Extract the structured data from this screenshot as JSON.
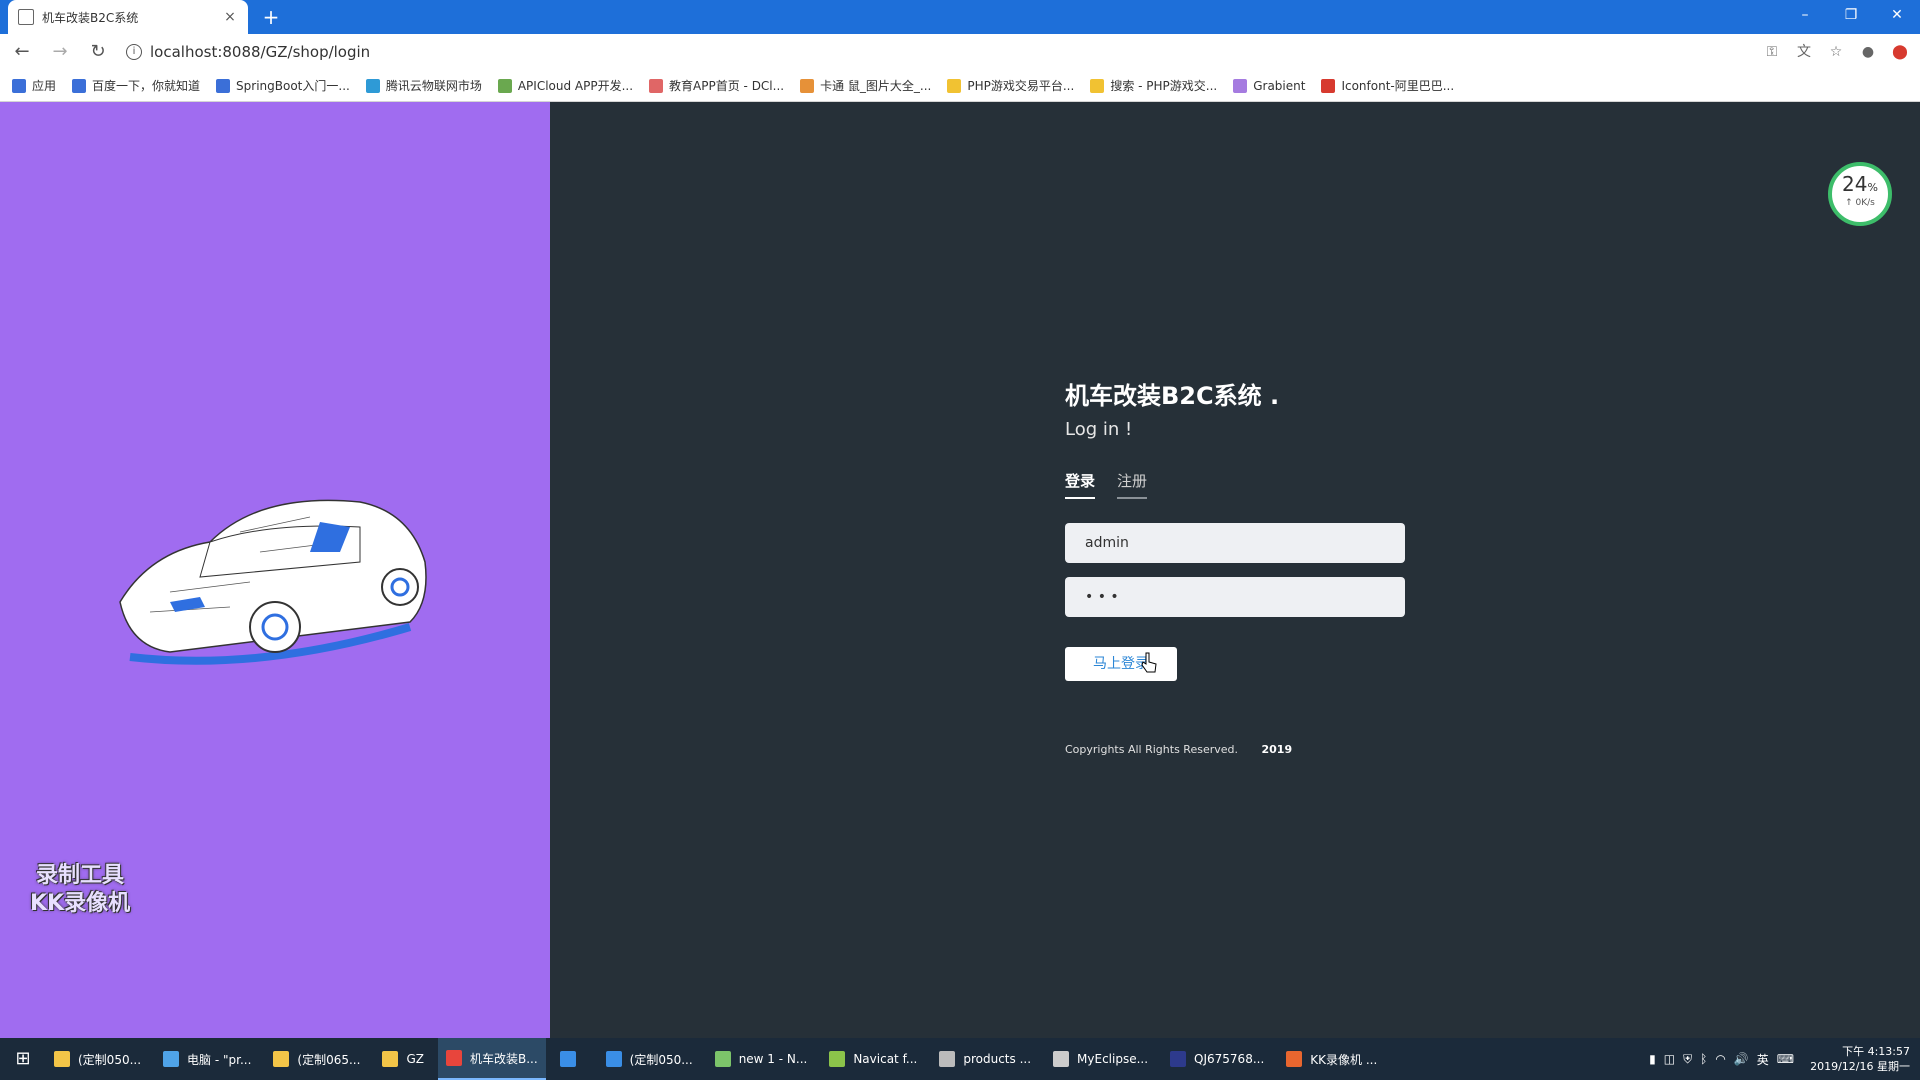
{
  "browser": {
    "tab_title": "机车改装B2C系统",
    "tab_close": "×",
    "new_tab": "+",
    "url": "localhost:8088/GZ/shop/login",
    "window_controls": [
      "–",
      "❐",
      "✕"
    ]
  },
  "bookmarks": [
    {
      "label": "应用",
      "color": "#3b6fd8"
    },
    {
      "label": "百度一下，你就知道",
      "color": "#3b6fd8"
    },
    {
      "label": "SpringBoot入门一...",
      "color": "#3b6fd8"
    },
    {
      "label": "腾讯云物联网市场",
      "color": "#2e9ad6"
    },
    {
      "label": "APICloud APP开发...",
      "color": "#6aa84f"
    },
    {
      "label": "教育APP首页 - DCl...",
      "color": "#e06666"
    },
    {
      "label": "卡通 鼠_图片大全_...",
      "color": "#e69138"
    },
    {
      "label": "PHP游戏交易平台...",
      "color": "#f1c232"
    },
    {
      "label": "搜索 - PHP游戏交...",
      "color": "#f1c232"
    },
    {
      "label": "Grabient",
      "color": "#a57be0"
    },
    {
      "label": "Iconfont-阿里巴巴...",
      "color": "#d73a2f"
    }
  ],
  "speed_widget": {
    "percent": "24",
    "unit": "%",
    "rate": "↑ 0K/s"
  },
  "login": {
    "title": "机车改装B2C系统 .",
    "subtitle": "Log in !",
    "tab_login": "登录",
    "tab_register": "注册",
    "username_value": "admin",
    "password_mask": "• • •",
    "submit_label": "马上登录",
    "copyright": "Copyrights All Rights Reserved.",
    "year": "2019"
  },
  "watermark": {
    "line1": "录制工具",
    "line2": "KK录像机"
  },
  "taskbar": {
    "items": [
      {
        "label": "(定制050...",
        "color": "#f3c548"
      },
      {
        "label": "电脑 - \"pr...",
        "color": "#4fa3e8"
      },
      {
        "label": "(定制065...",
        "color": "#f3c548"
      },
      {
        "label": "GZ",
        "color": "#f3c548"
      },
      {
        "label": "机车改装B...",
        "color": "#e8453c",
        "active": true
      },
      {
        "label": "",
        "color": "#3a8ee6"
      },
      {
        "label": "(定制050...",
        "color": "#3a8ee6"
      },
      {
        "label": "new 1 - N...",
        "color": "#7cc46a"
      },
      {
        "label": "Navicat f...",
        "color": "#8bc34a"
      },
      {
        "label": "products ...",
        "color": "#bbbbbb"
      },
      {
        "label": "MyEclipse...",
        "color": "#cccccc"
      },
      {
        "label": "QJ675768...",
        "color": "#2d3a8c"
      },
      {
        "label": "KK录像机 ...",
        "color": "#e8662f"
      }
    ],
    "ime": "英",
    "time": "下午 4:13:57",
    "date": "2019/12/16 星期一"
  }
}
